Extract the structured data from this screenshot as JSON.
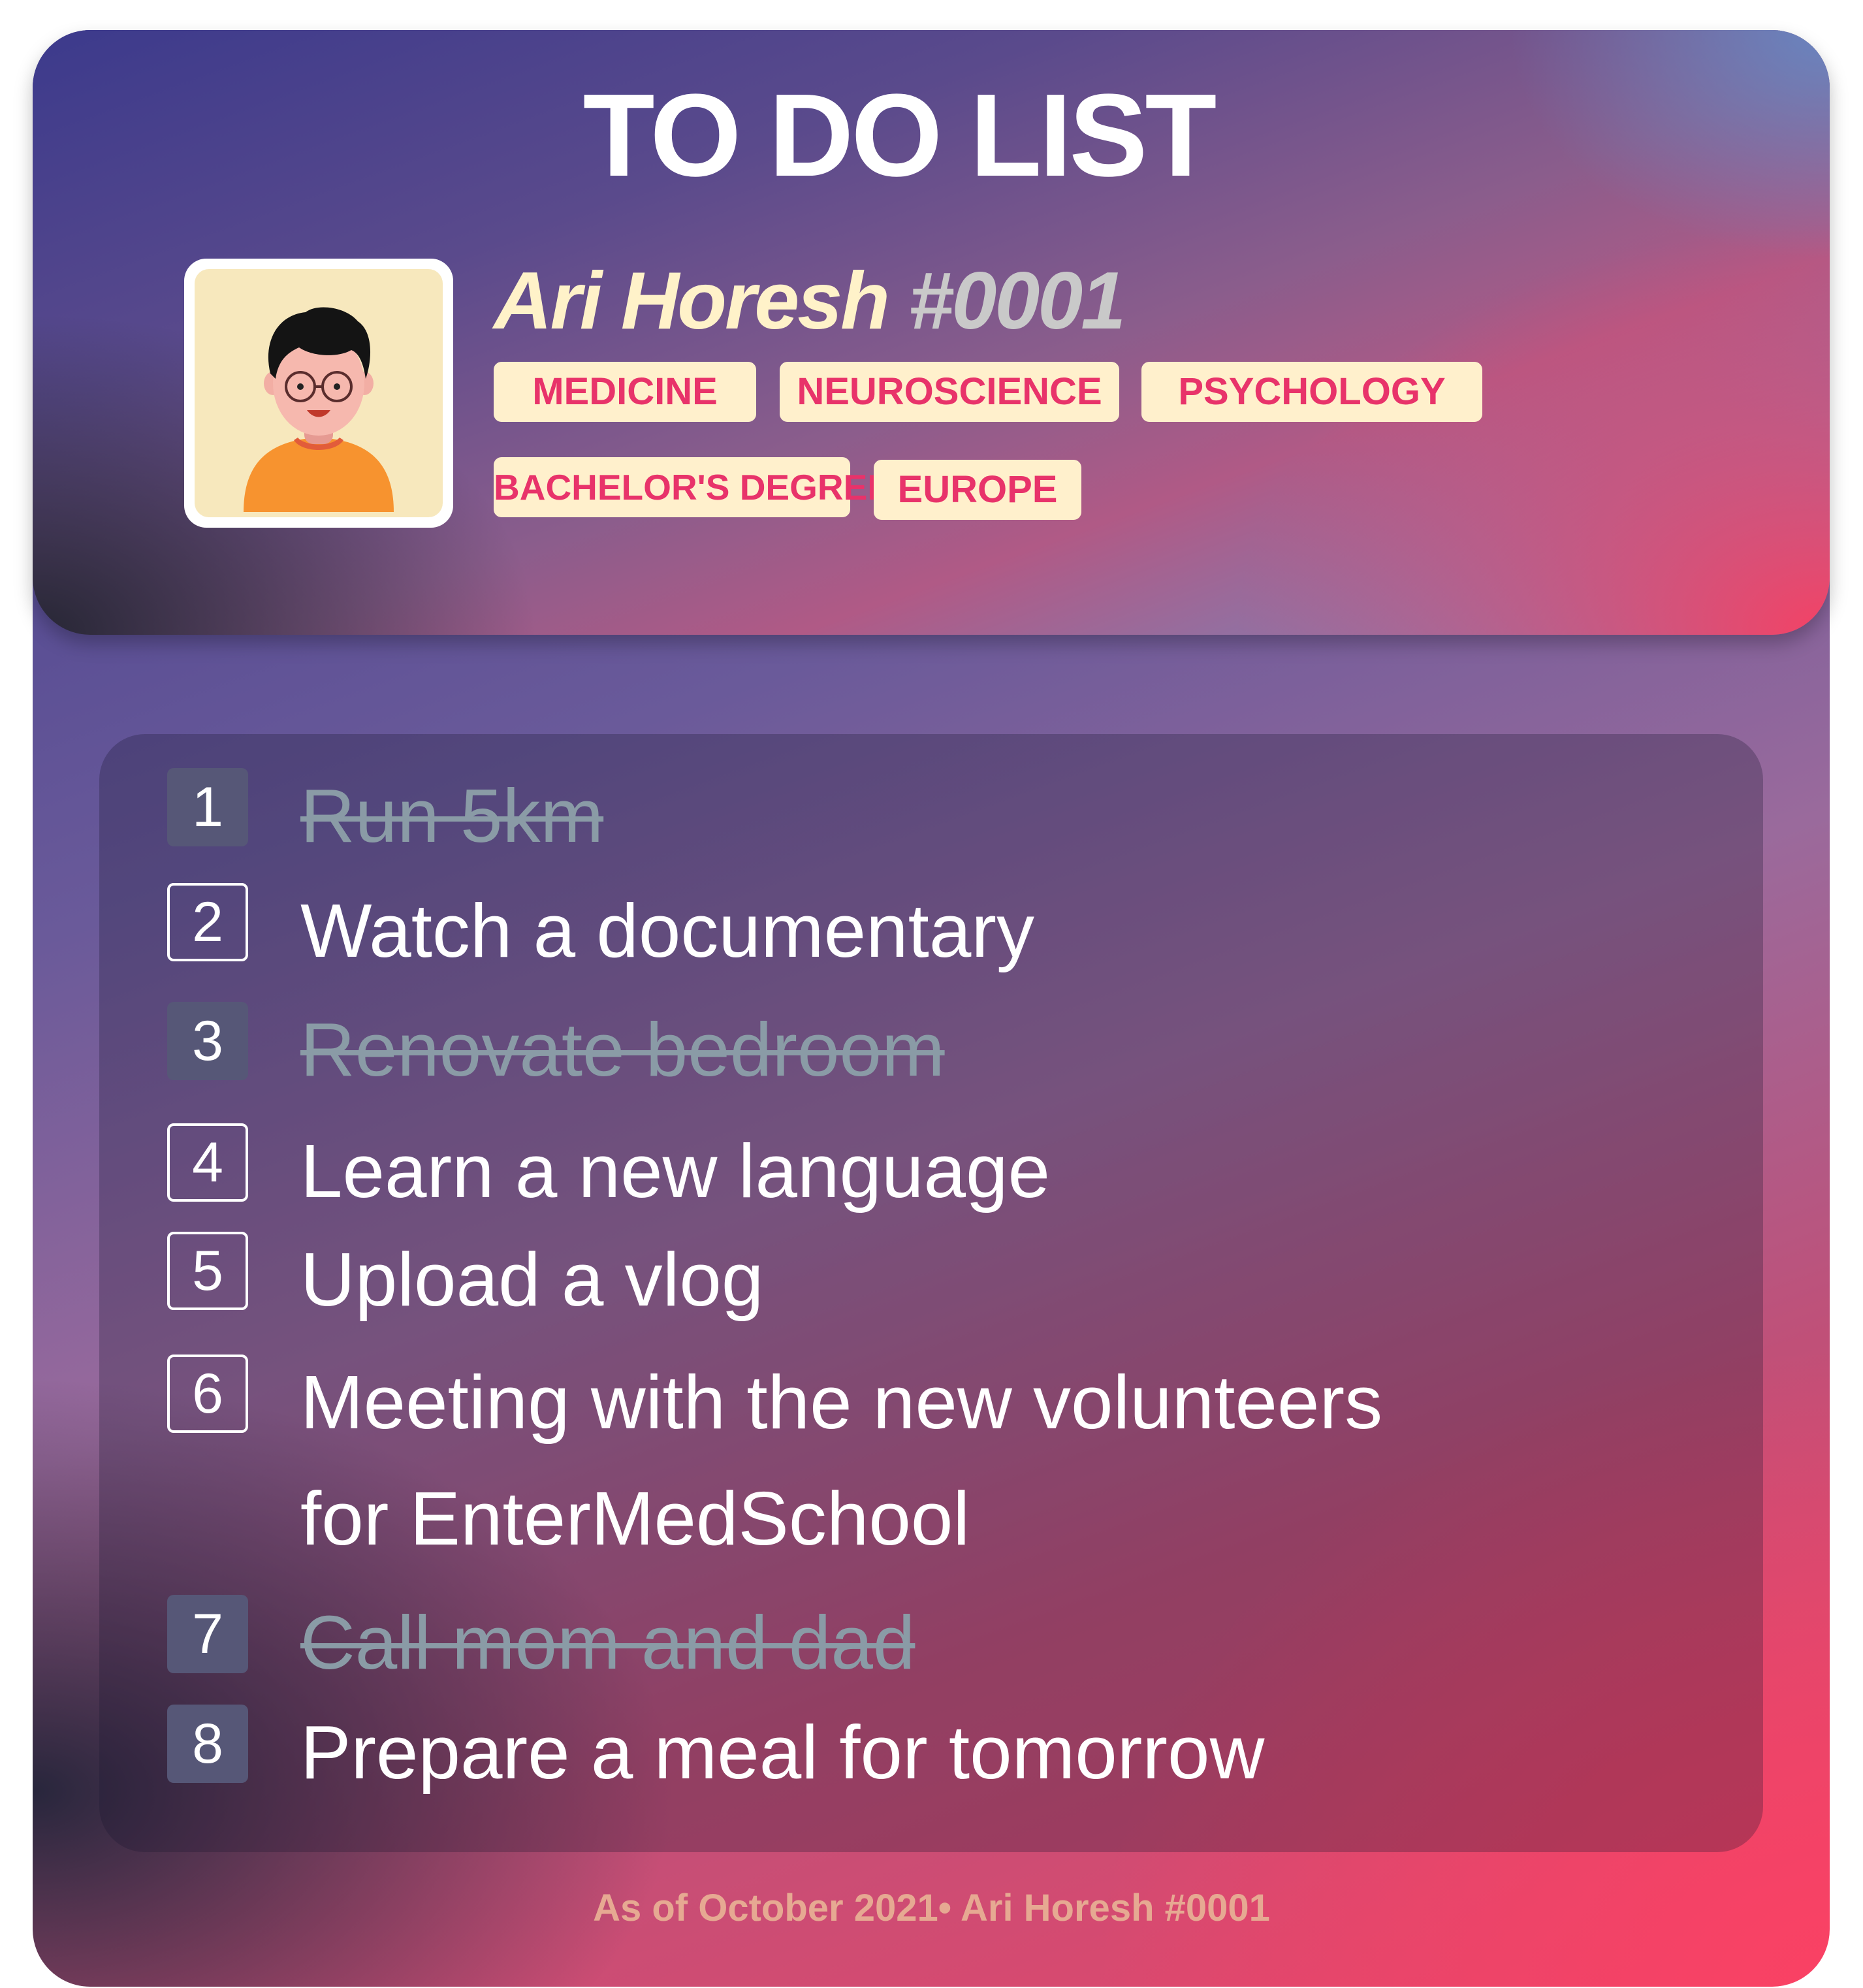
{
  "title": "TO DO LIST",
  "profile": {
    "name": "Ari Horesh",
    "tag": "#0001",
    "avatar_icon": "avatar-boy-glasses-icon",
    "chips": [
      "MEDICINE",
      "NEUROSCIENCE",
      "PSYCHOLOGY",
      "BACHELOR'S DEGREE",
      "EUROPE"
    ]
  },
  "todos": [
    {
      "num": "1",
      "text": "Run 5km",
      "done": true
    },
    {
      "num": "2",
      "text": "Watch a documentary",
      "done": false
    },
    {
      "num": "3",
      "text": "Renovate bedroom",
      "done": true
    },
    {
      "num": "4",
      "text": "Learn a new language",
      "done": false
    },
    {
      "num": "5",
      "text": "Upload a vlog",
      "done": false
    },
    {
      "num": "6",
      "text": "Meeting with the new volunteers",
      "text_line2": "for EnterMedSchool",
      "done": false
    },
    {
      "num": "7",
      "text": "Call mom and dad",
      "done": true
    },
    {
      "num": "8",
      "text": "Prepare a meal for tomorrow",
      "done": false,
      "box_style": "filled"
    }
  ],
  "footer": "As of October 2021• Ari Horesh #0001",
  "colors": {
    "chip_bg": "#fff0cc",
    "chip_text": "#e8336a",
    "name_text": "#fff2c9",
    "tag_text": "#c9c9c9",
    "done_text": "#8a9ba6",
    "footer_text": "#e6a992"
  }
}
